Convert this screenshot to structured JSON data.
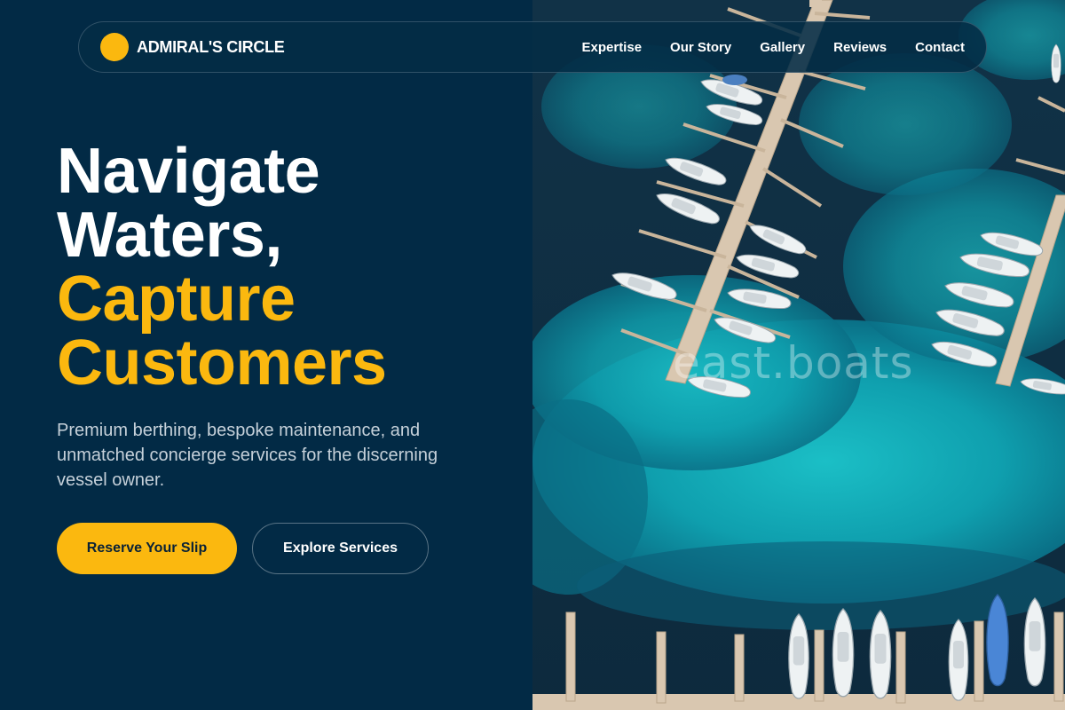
{
  "brand": {
    "name": "ADMIRAL'S CIRCLE"
  },
  "nav": {
    "links": [
      "Expertise",
      "Our Story",
      "Gallery",
      "Reviews",
      "Contact"
    ]
  },
  "hero": {
    "line1": "Navigate",
    "line2": "Waters,",
    "line3": "Capture",
    "line4": "Customers",
    "subtitle": "Premium berthing, bespoke maintenance, and unmatched concierge services for the discerning vessel owner.",
    "primary_cta": "Reserve Your Slip",
    "secondary_cta": "Explore Services"
  },
  "photo": {
    "watermark": "east.boats"
  },
  "colors": {
    "navy": "#022a45",
    "gold": "#fbb80f",
    "water_turquoise": "#12a6b4",
    "water_deep": "#0b2f46"
  }
}
